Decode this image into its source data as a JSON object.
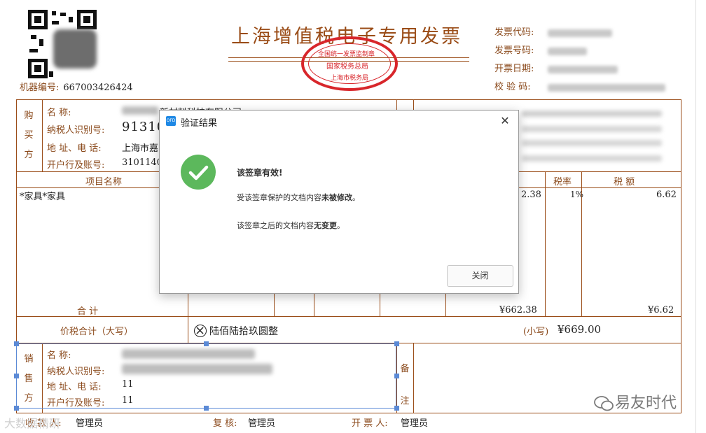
{
  "invoice": {
    "title": "上海增值税电子专用发票",
    "seal": {
      "line1": "全国统一发票监制章",
      "line2": "国家税务总局",
      "line3": "上海市税务局"
    },
    "machine_label": "机器编号:",
    "machine_no": "667003426424",
    "meta": {
      "code_label": "发票代码:",
      "number_label": "发票号码:",
      "date_label": "开票日期:",
      "check_label": "校 验 码:"
    },
    "buyer": {
      "side_label": [
        "购",
        "买",
        "方"
      ],
      "name_label": "名        称:",
      "name_value": "新材料科技有限公司",
      "tax_label": "纳税人识别号:",
      "tax_value": "91310",
      "addr_label": "地 址、电 话:",
      "addr_value": "上海市嘉",
      "bank_label": "开户行及账号:",
      "bank_value": "3101140"
    },
    "items_header": {
      "name": "项目名称",
      "tax_rate": "税率",
      "tax_amount": "税    额"
    },
    "item": {
      "name": "*家具*家具",
      "amount_partial": "2.38",
      "rate": "1%",
      "tax": "6.62"
    },
    "total": {
      "label": "合        计",
      "amount": "¥662.38",
      "tax": "¥6.62"
    },
    "grand_total": {
      "label": "价税合计（大写）",
      "words": "陆佰陆拾玖圆整",
      "small_label": "(小写)",
      "small_value": "¥669.00"
    },
    "seller": {
      "side_label": [
        "销",
        "售",
        "方"
      ],
      "name_label": "名        称:",
      "tax_label": "纳税人识别号:",
      "addr_label": "地 址、电 话:",
      "addr_value": "11",
      "bank_label": "开户行及账号:",
      "bank_value": "11"
    },
    "remark_label": [
      "备",
      "注"
    ],
    "footer": {
      "payee_label": "收 款 人:",
      "payee_value": "管理员",
      "reviewer_label": "复    核:",
      "reviewer_value": "管理员",
      "drawer_label": "开 票 人:",
      "drawer_value": "管理员"
    }
  },
  "dialog": {
    "icon_text": "OFD",
    "title": "验证结果",
    "close_symbol": "✕",
    "msg_title": "该签章有效!",
    "msg_line1_prefix": "受该签章保护的文档内容",
    "msg_line1_bold": "未被修改",
    "msg_line1_suffix": "。",
    "msg_line2_prefix": "该签章之后的文档内容",
    "msg_line2_bold": "无变更",
    "msg_line2_suffix": "。",
    "button_label": "关闭"
  },
  "watermark": {
    "text": "易友时代",
    "corner": "大数据精研"
  },
  "colors": {
    "invoice_brown": "#9a4c17",
    "seal_red": "#d8262b",
    "success_green": "#5cb85c",
    "selection_blue": "#5b8ad6"
  }
}
